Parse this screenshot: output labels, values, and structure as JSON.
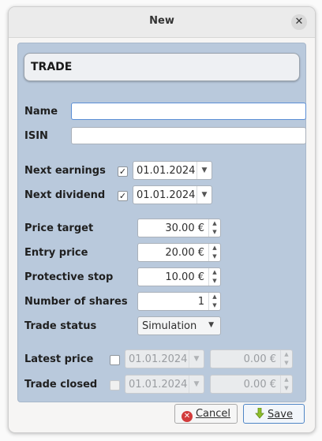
{
  "window": {
    "title": "New",
    "close_icon": "close-icon"
  },
  "header": {
    "title": "TRADE"
  },
  "form": {
    "name": {
      "label": "Name",
      "value": ""
    },
    "isin": {
      "label": "ISIN",
      "value": ""
    },
    "next_earnings": {
      "label": "Next earnings",
      "checked": true,
      "date": "01.01.2024"
    },
    "next_dividend": {
      "label": "Next dividend",
      "checked": true,
      "date": "01.01.2024"
    },
    "price_target": {
      "label": "Price target",
      "value": "30.00 €"
    },
    "entry_price": {
      "label": "Entry price",
      "value": "20.00 €"
    },
    "protective_stop": {
      "label": "Protective stop",
      "value": "10.00 €"
    },
    "number_of_shares": {
      "label": "Number of shares",
      "value": "1"
    },
    "trade_status": {
      "label": "Trade status",
      "value": "Simulation"
    },
    "latest_price": {
      "label": "Latest price",
      "checked": false,
      "date": "01.01.2024",
      "value": "0.00 €"
    },
    "trade_closed": {
      "label": "Trade closed",
      "checked": false,
      "date": "01.01.2024",
      "value": "0.00 €"
    }
  },
  "buttons": {
    "cancel_prefix": "",
    "cancel": "Cancel",
    "save": "Save"
  },
  "colors": {
    "panel": "#b9c9dc",
    "accent": "#4f86c6",
    "cancel": "#d23b3b",
    "save_icon": "#8fbf2b"
  }
}
